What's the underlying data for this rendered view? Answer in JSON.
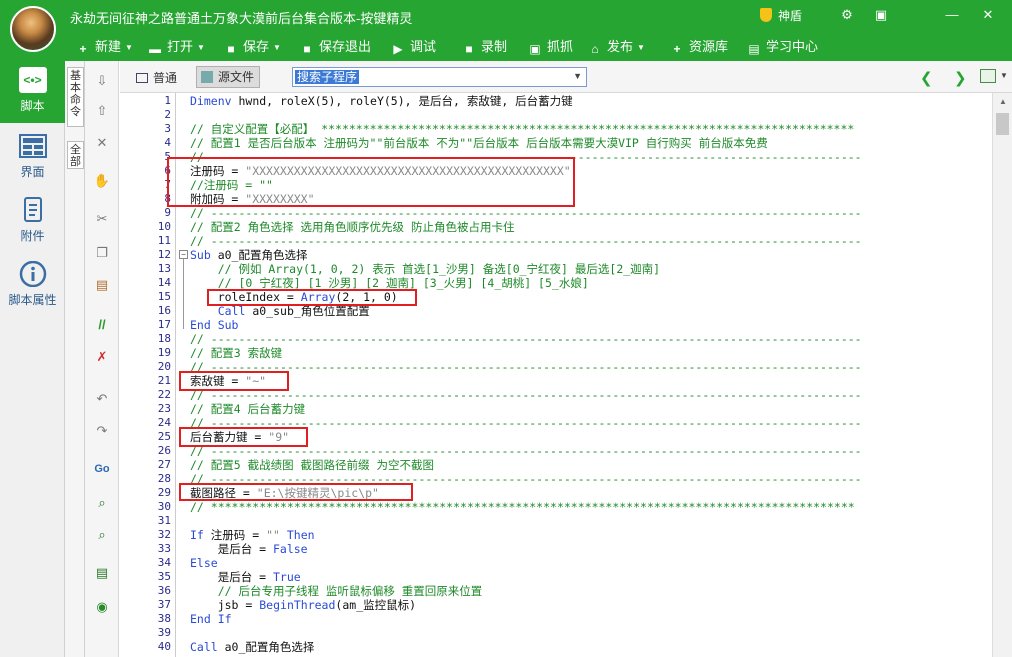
{
  "window": {
    "title": "永劫无间征神之路普通土万象大漠前后台集合版本-按键精灵",
    "badge": "神盾",
    "controls": [
      "⚙",
      "▣",
      "—",
      "✕"
    ]
  },
  "toolbar": {
    "items": [
      {
        "label": "新建",
        "icon": "plus-icon",
        "glyph": "+",
        "dropdown": true
      },
      {
        "label": "打开",
        "icon": "folder-icon",
        "glyph": "▬",
        "dropdown": true
      },
      {
        "label": "保存",
        "icon": "save-icon",
        "glyph": "■",
        "dropdown": true
      },
      {
        "label": "保存退出",
        "icon": "save-exit-icon",
        "glyph": "■",
        "dropdown": false
      },
      {
        "label": "调试",
        "icon": "debug-icon",
        "glyph": "▶",
        "dropdown": false
      },
      {
        "label": "录制",
        "icon": "record-icon",
        "glyph": "■",
        "dropdown": false
      },
      {
        "label": "抓抓",
        "icon": "capture-icon",
        "glyph": "▣",
        "dropdown": false
      },
      {
        "label": "发布",
        "icon": "publish-icon",
        "glyph": "⌂",
        "dropdown": true
      },
      {
        "label": "资源库",
        "icon": "resource-icon",
        "glyph": "+",
        "dropdown": false
      },
      {
        "label": "学习中心",
        "icon": "learn-icon",
        "glyph": "▤",
        "dropdown": false
      }
    ]
  },
  "leftnav": {
    "items": [
      {
        "label": "脚本",
        "icon": "script-icon",
        "glyph": "<•>"
      },
      {
        "label": "界面",
        "icon": "layout-icon",
        "glyph": "▦"
      },
      {
        "label": "附件",
        "icon": "attachment-icon",
        "glyph": "▤"
      },
      {
        "label": "脚本属性",
        "icon": "info-icon",
        "glyph": "i"
      }
    ]
  },
  "vtabs": [
    "基本命令",
    "全部"
  ],
  "modebar": {
    "tab_normal": "普通",
    "tab_source": "源文件",
    "sub_select": "搜索子程序"
  },
  "code": {
    "lines": [
      {
        "n": "1",
        "segs": [
          {
            "c": "kw",
            "t": "Dimenv"
          },
          {
            "c": "",
            "t": " hwnd, roleX(5), roleY(5), 是后台, 索敌键, 后台蓄力键"
          }
        ]
      },
      {
        "n": "2",
        "segs": []
      },
      {
        "n": "3",
        "segs": [
          {
            "c": "cm",
            "t": "// 自定义配置【必配】 *****************************************************************************"
          }
        ]
      },
      {
        "n": "4",
        "segs": [
          {
            "c": "cm",
            "t": "// 配置1 是否后台版本 注册码为\"\"前台版本 不为\"\"后台版本 后台版本需要大漠VIP 自行购买 前台版本免费"
          }
        ]
      },
      {
        "n": "5",
        "segs": [
          {
            "c": "cm",
            "t": "// ----------------------------------------------------------------------------------------------"
          }
        ]
      },
      {
        "n": "6",
        "segs": [
          {
            "c": "",
            "t": "注册码 = "
          },
          {
            "c": "st2",
            "t": "\"XXXXXXXXXXXXXXXXXXXXXXXXXXXXXXXXXXXXXXXXXXXXX\""
          }
        ]
      },
      {
        "n": "7",
        "segs": [
          {
            "c": "cm",
            "t": "//注册码 = \"\""
          }
        ]
      },
      {
        "n": "8",
        "segs": [
          {
            "c": "",
            "t": "附加码 = "
          },
          {
            "c": "st2",
            "t": "\"XXXXXXXX\""
          }
        ]
      },
      {
        "n": "9",
        "segs": [
          {
            "c": "cm",
            "t": "// ----------------------------------------------------------------------------------------------"
          }
        ]
      },
      {
        "n": "10",
        "segs": [
          {
            "c": "cm",
            "t": "// 配置2 角色选择 选用角色顺序优先级 防止角色被占用卡住"
          }
        ]
      },
      {
        "n": "11",
        "segs": [
          {
            "c": "cm",
            "t": "// ----------------------------------------------------------------------------------------------"
          }
        ]
      },
      {
        "n": "12",
        "segs": [
          {
            "c": "kw",
            "t": "Sub"
          },
          {
            "c": "",
            "t": " a0_配置角色选择"
          }
        ]
      },
      {
        "n": "13",
        "segs": [
          {
            "c": "cm",
            "t": "    // 例如 Array(1, 0, 2) 表示 首选[1_沙男] 备选[0_宁红夜] 最后选[2_迦南]"
          }
        ]
      },
      {
        "n": "14",
        "segs": [
          {
            "c": "cm",
            "t": "    // [0_宁红夜] [1_沙男] [2_迦南] [3_火男] [4_胡桃] [5_水娘]"
          }
        ]
      },
      {
        "n": "15",
        "segs": [
          {
            "c": "",
            "t": "    roleIndex = "
          },
          {
            "c": "kw",
            "t": "Array"
          },
          {
            "c": "",
            "t": "(2, 1, 0)"
          }
        ]
      },
      {
        "n": "16",
        "segs": [
          {
            "c": "",
            "t": "    "
          },
          {
            "c": "kw",
            "t": "Call"
          },
          {
            "c": "",
            "t": " a0_sub_角色位置配置"
          }
        ]
      },
      {
        "n": "17",
        "segs": [
          {
            "c": "kw",
            "t": "End Sub"
          }
        ]
      },
      {
        "n": "18",
        "segs": [
          {
            "c": "cm",
            "t": "// ----------------------------------------------------------------------------------------------"
          }
        ]
      },
      {
        "n": "19",
        "segs": [
          {
            "c": "cm",
            "t": "// 配置3 索敌键"
          }
        ]
      },
      {
        "n": "20",
        "segs": [
          {
            "c": "cm",
            "t": "// ----------------------------------------------------------------------------------------------"
          }
        ]
      },
      {
        "n": "21",
        "segs": [
          {
            "c": "",
            "t": "索敌键 = "
          },
          {
            "c": "st2",
            "t": "\"~\""
          }
        ]
      },
      {
        "n": "22",
        "segs": [
          {
            "c": "cm",
            "t": "// ----------------------------------------------------------------------------------------------"
          }
        ]
      },
      {
        "n": "23",
        "segs": [
          {
            "c": "cm",
            "t": "// 配置4 后台蓄力键"
          }
        ]
      },
      {
        "n": "24",
        "segs": [
          {
            "c": "cm",
            "t": "// ----------------------------------------------------------------------------------------------"
          }
        ]
      },
      {
        "n": "25",
        "segs": [
          {
            "c": "",
            "t": "后台蓄力键 = "
          },
          {
            "c": "st2",
            "t": "\"9\""
          }
        ]
      },
      {
        "n": "26",
        "segs": [
          {
            "c": "cm",
            "t": "// ----------------------------------------------------------------------------------------------"
          }
        ]
      },
      {
        "n": "27",
        "segs": [
          {
            "c": "cm",
            "t": "// 配置5 截战绩图 截图路径前缀 为空不截图"
          }
        ]
      },
      {
        "n": "28",
        "segs": [
          {
            "c": "cm",
            "t": "// ----------------------------------------------------------------------------------------------"
          }
        ]
      },
      {
        "n": "29",
        "segs": [
          {
            "c": "",
            "t": "截图路径 = "
          },
          {
            "c": "st2",
            "t": "\"E:\\按键精灵\\pic\\p\""
          }
        ]
      },
      {
        "n": "30",
        "segs": [
          {
            "c": "cm",
            "t": "// *********************************************************************************************"
          }
        ]
      },
      {
        "n": "31",
        "segs": []
      },
      {
        "n": "32",
        "segs": [
          {
            "c": "kw",
            "t": "If"
          },
          {
            "c": "",
            "t": " 注册码 = "
          },
          {
            "c": "st2",
            "t": "\"\""
          },
          {
            "c": "",
            "t": " "
          },
          {
            "c": "kw",
            "t": "Then"
          }
        ]
      },
      {
        "n": "33",
        "segs": [
          {
            "c": "",
            "t": "    是后台 = "
          },
          {
            "c": "kw",
            "t": "False"
          }
        ]
      },
      {
        "n": "34",
        "segs": [
          {
            "c": "kw",
            "t": "Else"
          }
        ]
      },
      {
        "n": "35",
        "segs": [
          {
            "c": "",
            "t": "    是后台 = "
          },
          {
            "c": "kw",
            "t": "True"
          }
        ]
      },
      {
        "n": "36",
        "segs": [
          {
            "c": "cm",
            "t": "    // 后台专用子线程 监听鼠标偏移 重置回原来位置"
          }
        ]
      },
      {
        "n": "37",
        "segs": [
          {
            "c": "",
            "t": "    jsb = "
          },
          {
            "c": "kw",
            "t": "BeginThread"
          },
          {
            "c": "",
            "t": "(am_监控鼠标)"
          }
        ]
      },
      {
        "n": "38",
        "segs": [
          {
            "c": "kw",
            "t": "End If"
          }
        ]
      },
      {
        "n": "39",
        "segs": []
      },
      {
        "n": "40",
        "segs": [
          {
            "c": "kw",
            "t": "Call"
          },
          {
            "c": "",
            "t": " a0_配置角色选择"
          }
        ]
      }
    ]
  }
}
